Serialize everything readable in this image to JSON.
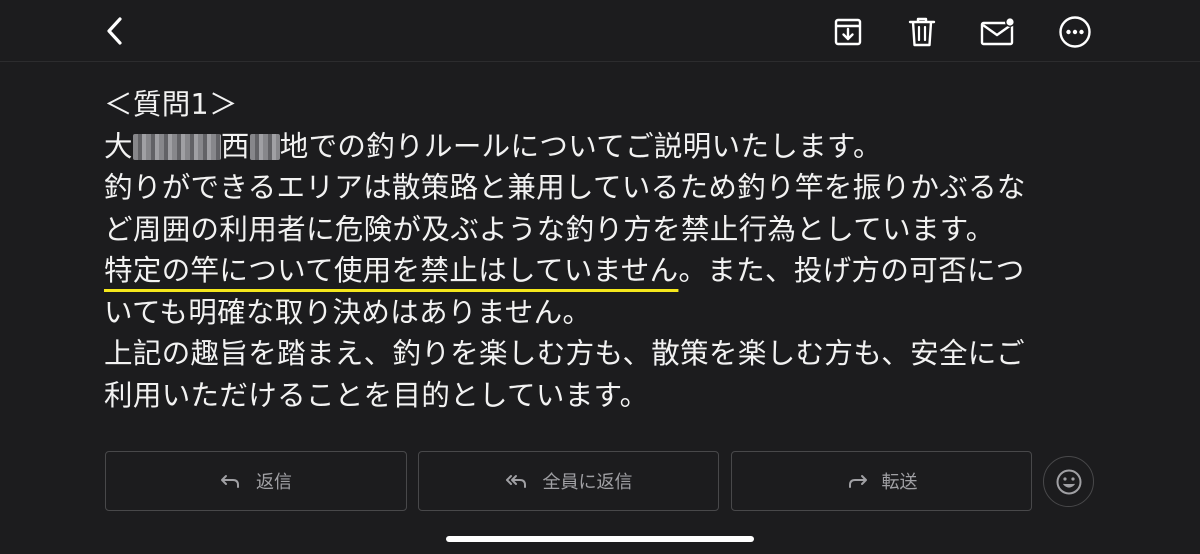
{
  "toolbar": {
    "back_icon": "chevron-left-icon",
    "archive_icon": "archive-tray-icon",
    "trash_icon": "trash-icon",
    "unread_icon": "envelope-unread-icon",
    "more_icon": "ellipsis-circle-icon"
  },
  "message": {
    "line1": "＜質問1＞",
    "line2_a": "大",
    "line2_b": "西",
    "line2_c": "地での釣りルールについてご説明いたします。",
    "line3": "釣りができるエリアは散策路と兼用しているため釣り竿を振りかぶるな",
    "line4": "ど周囲の利用者に危険が及ぶような釣り方を禁止行為としています。",
    "line5_highlight": "特定の竿について使用を禁止はしていません",
    "line5_rest": "。また、投げ方の可否につ",
    "line6": "いても明確な取り決めはありません。",
    "line7": "上記の趣旨を踏まえ、釣りを楽しむ方も、散策を楽しむ方も、安全にご",
    "line8": "利用いただけることを目的としています。"
  },
  "actions": {
    "reply_label": "返信",
    "reply_all_label": "全員に返信",
    "forward_label": "転送",
    "emoji_icon": "smiley-face-icon"
  },
  "colors": {
    "background": "#1c1c1e",
    "text": "#f2f2f2",
    "highlight_underline": "#f5e71c",
    "button_border": "#48484a",
    "button_text": "#a0a0a4"
  }
}
